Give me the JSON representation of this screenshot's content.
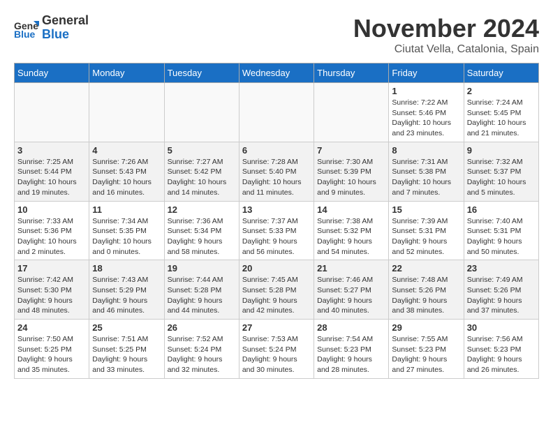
{
  "header": {
    "logo_line1": "General",
    "logo_line2": "Blue",
    "month": "November 2024",
    "location": "Ciutat Vella, Catalonia, Spain"
  },
  "weekdays": [
    "Sunday",
    "Monday",
    "Tuesday",
    "Wednesday",
    "Thursday",
    "Friday",
    "Saturday"
  ],
  "weeks": [
    [
      {
        "day": "",
        "info": ""
      },
      {
        "day": "",
        "info": ""
      },
      {
        "day": "",
        "info": ""
      },
      {
        "day": "",
        "info": ""
      },
      {
        "day": "",
        "info": ""
      },
      {
        "day": "1",
        "info": "Sunrise: 7:22 AM\nSunset: 5:46 PM\nDaylight: 10 hours and 23 minutes."
      },
      {
        "day": "2",
        "info": "Sunrise: 7:24 AM\nSunset: 5:45 PM\nDaylight: 10 hours and 21 minutes."
      }
    ],
    [
      {
        "day": "3",
        "info": "Sunrise: 7:25 AM\nSunset: 5:44 PM\nDaylight: 10 hours and 19 minutes."
      },
      {
        "day": "4",
        "info": "Sunrise: 7:26 AM\nSunset: 5:43 PM\nDaylight: 10 hours and 16 minutes."
      },
      {
        "day": "5",
        "info": "Sunrise: 7:27 AM\nSunset: 5:42 PM\nDaylight: 10 hours and 14 minutes."
      },
      {
        "day": "6",
        "info": "Sunrise: 7:28 AM\nSunset: 5:40 PM\nDaylight: 10 hours and 11 minutes."
      },
      {
        "day": "7",
        "info": "Sunrise: 7:30 AM\nSunset: 5:39 PM\nDaylight: 10 hours and 9 minutes."
      },
      {
        "day": "8",
        "info": "Sunrise: 7:31 AM\nSunset: 5:38 PM\nDaylight: 10 hours and 7 minutes."
      },
      {
        "day": "9",
        "info": "Sunrise: 7:32 AM\nSunset: 5:37 PM\nDaylight: 10 hours and 5 minutes."
      }
    ],
    [
      {
        "day": "10",
        "info": "Sunrise: 7:33 AM\nSunset: 5:36 PM\nDaylight: 10 hours and 2 minutes."
      },
      {
        "day": "11",
        "info": "Sunrise: 7:34 AM\nSunset: 5:35 PM\nDaylight: 10 hours and 0 minutes."
      },
      {
        "day": "12",
        "info": "Sunrise: 7:36 AM\nSunset: 5:34 PM\nDaylight: 9 hours and 58 minutes."
      },
      {
        "day": "13",
        "info": "Sunrise: 7:37 AM\nSunset: 5:33 PM\nDaylight: 9 hours and 56 minutes."
      },
      {
        "day": "14",
        "info": "Sunrise: 7:38 AM\nSunset: 5:32 PM\nDaylight: 9 hours and 54 minutes."
      },
      {
        "day": "15",
        "info": "Sunrise: 7:39 AM\nSunset: 5:31 PM\nDaylight: 9 hours and 52 minutes."
      },
      {
        "day": "16",
        "info": "Sunrise: 7:40 AM\nSunset: 5:31 PM\nDaylight: 9 hours and 50 minutes."
      }
    ],
    [
      {
        "day": "17",
        "info": "Sunrise: 7:42 AM\nSunset: 5:30 PM\nDaylight: 9 hours and 48 minutes."
      },
      {
        "day": "18",
        "info": "Sunrise: 7:43 AM\nSunset: 5:29 PM\nDaylight: 9 hours and 46 minutes."
      },
      {
        "day": "19",
        "info": "Sunrise: 7:44 AM\nSunset: 5:28 PM\nDaylight: 9 hours and 44 minutes."
      },
      {
        "day": "20",
        "info": "Sunrise: 7:45 AM\nSunset: 5:28 PM\nDaylight: 9 hours and 42 minutes."
      },
      {
        "day": "21",
        "info": "Sunrise: 7:46 AM\nSunset: 5:27 PM\nDaylight: 9 hours and 40 minutes."
      },
      {
        "day": "22",
        "info": "Sunrise: 7:48 AM\nSunset: 5:26 PM\nDaylight: 9 hours and 38 minutes."
      },
      {
        "day": "23",
        "info": "Sunrise: 7:49 AM\nSunset: 5:26 PM\nDaylight: 9 hours and 37 minutes."
      }
    ],
    [
      {
        "day": "24",
        "info": "Sunrise: 7:50 AM\nSunset: 5:25 PM\nDaylight: 9 hours and 35 minutes."
      },
      {
        "day": "25",
        "info": "Sunrise: 7:51 AM\nSunset: 5:25 PM\nDaylight: 9 hours and 33 minutes."
      },
      {
        "day": "26",
        "info": "Sunrise: 7:52 AM\nSunset: 5:24 PM\nDaylight: 9 hours and 32 minutes."
      },
      {
        "day": "27",
        "info": "Sunrise: 7:53 AM\nSunset: 5:24 PM\nDaylight: 9 hours and 30 minutes."
      },
      {
        "day": "28",
        "info": "Sunrise: 7:54 AM\nSunset: 5:23 PM\nDaylight: 9 hours and 28 minutes."
      },
      {
        "day": "29",
        "info": "Sunrise: 7:55 AM\nSunset: 5:23 PM\nDaylight: 9 hours and 27 minutes."
      },
      {
        "day": "30",
        "info": "Sunrise: 7:56 AM\nSunset: 5:23 PM\nDaylight: 9 hours and 26 minutes."
      }
    ]
  ]
}
